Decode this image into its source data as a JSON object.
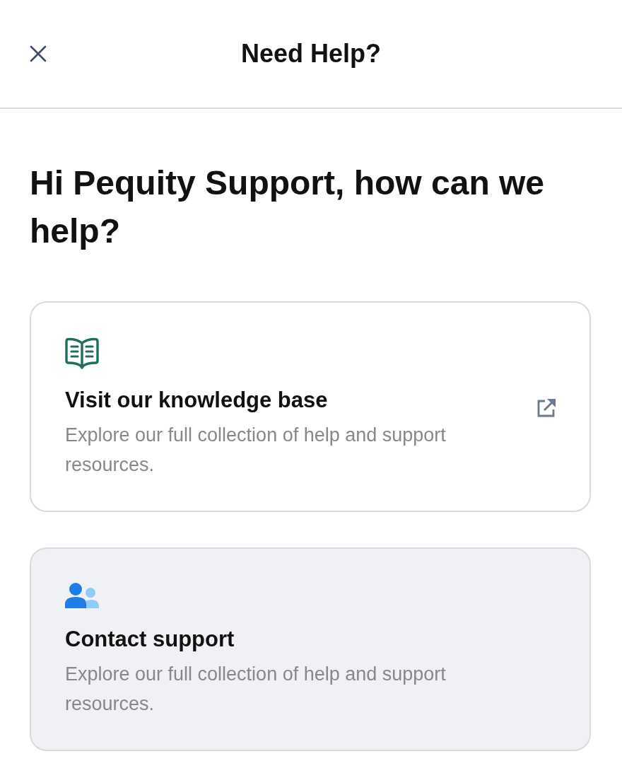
{
  "header": {
    "title": "Need Help?"
  },
  "greeting": "Hi Pequity Support, how can we help?",
  "cards": [
    {
      "kind": "knowledge",
      "title": "Visit our knowledge base",
      "description": "Explore our full collection of help and support resources.",
      "external": true,
      "highlighted": false
    },
    {
      "kind": "contact",
      "title": "Contact support",
      "description": "Explore our full collection of help and support resources.",
      "external": false,
      "highlighted": true
    }
  ]
}
